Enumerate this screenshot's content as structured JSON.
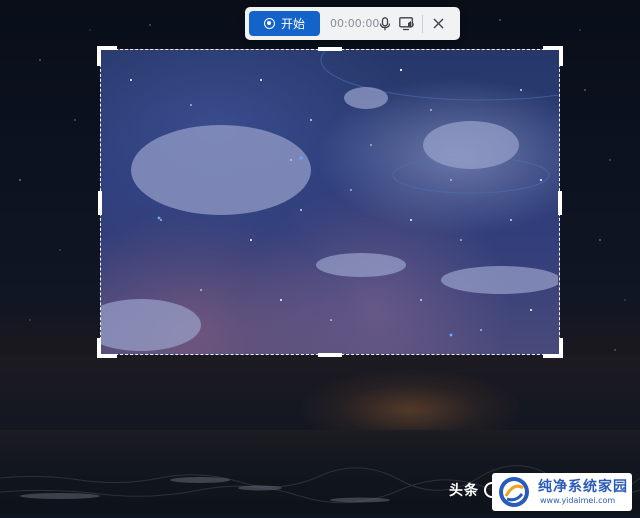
{
  "toolbar": {
    "start_label": "开始",
    "timer": "00:00:00",
    "icons": [
      "record-icon",
      "microphone-icon",
      "screen-audio-icon",
      "close-icon"
    ]
  },
  "capture": {
    "mode": "region-select"
  },
  "watermark": {
    "text": "头条",
    "logo_title": "纯净系统家园",
    "logo_url": "www.yidaimei.com"
  },
  "colors": {
    "accent": "#1463c8",
    "toolbar_bg": "#f1f2f4",
    "logo_blue": "#2a5bb8"
  }
}
